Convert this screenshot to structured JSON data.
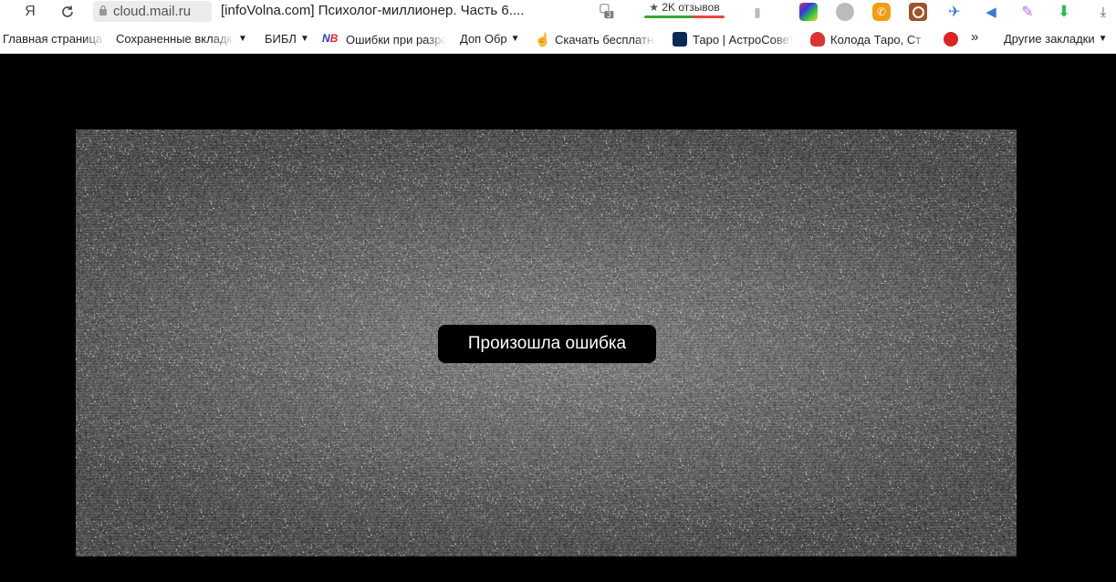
{
  "browser": {
    "yandex_logo": "Я",
    "url": "cloud.mail.ru",
    "tab_title": "[infoVolna.com] Психолог-миллионер. Часть 6....",
    "tab_count": "3",
    "reviews_label": "2K отзывов"
  },
  "bookmarks": [
    {
      "label": "Главная страница",
      "caret": ""
    },
    {
      "label": "Сохраненные вкладки",
      "caret": "▼"
    },
    {
      "label": "БИБЛ",
      "caret": "▼"
    },
    {
      "label": "Ошибки при разработке",
      "caret": ""
    },
    {
      "label": "Доп Обр",
      "caret": "▼"
    },
    {
      "label": "Скачать бесплатно",
      "caret": ""
    },
    {
      "label": "Таро | АстроСовет",
      "caret": ""
    },
    {
      "label": "Колода Таро, Ст",
      "caret": ""
    },
    {
      "label": "Другие закладки",
      "caret": "▼"
    }
  ],
  "video": {
    "error_message": "Произошла ошибка"
  },
  "colors": {
    "page_bg": "#000000",
    "reviews_good": "#33aa33",
    "reviews_bad": "#ee4444"
  }
}
